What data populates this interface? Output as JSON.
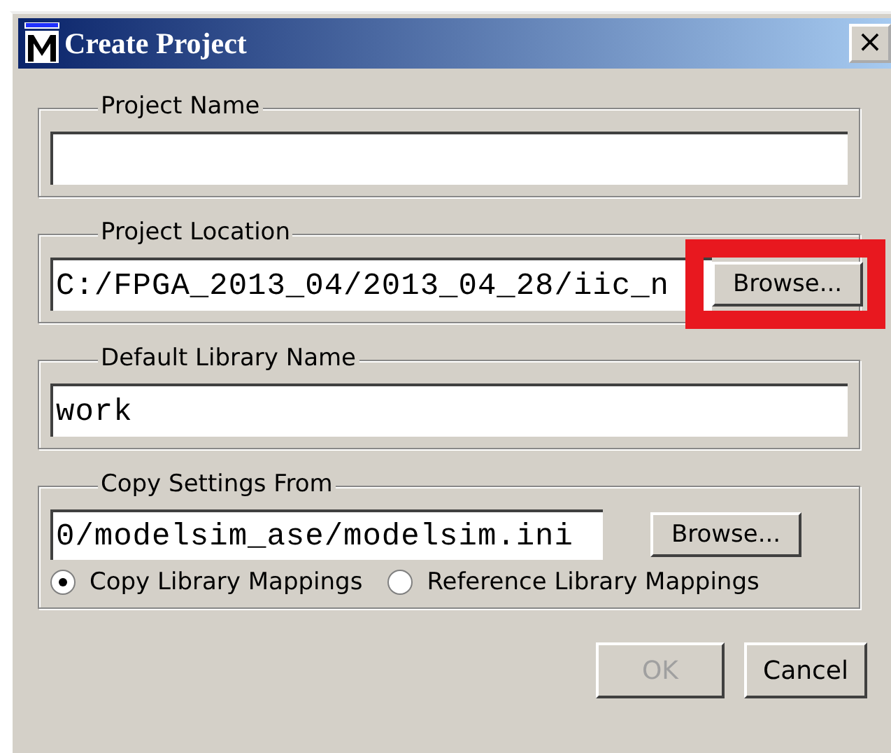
{
  "window": {
    "title": "Create Project",
    "close": "×"
  },
  "groups": [
    {
      "label": "Project Name"
    },
    {
      "label": "Project Location",
      "field": {
        "value": "C:/FPGA_2013_04/2013_04_28/iic_n"
      },
      "browse": {
        "label": "Browse...",
        "highlighted": true
      }
    },
    {
      "label": "Default Library Name",
      "field": {
        "value": "work"
      }
    },
    {
      "label": "Copy Settings From",
      "field": {
        "value": "0/modelsim_ase/modelsim.ini"
      },
      "browse": {
        "label": "Browse...",
        "highlighted": false
      },
      "options": [
        {
          "label": "Copy Library Mappings",
          "selected": true
        },
        {
          "label": "Reference Library Mappings",
          "selected": false
        }
      ]
    }
  ],
  "buttons": [
    {
      "label": "OK",
      "disabled": true
    },
    {
      "label": "Cancel",
      "disabled": false
    }
  ]
}
